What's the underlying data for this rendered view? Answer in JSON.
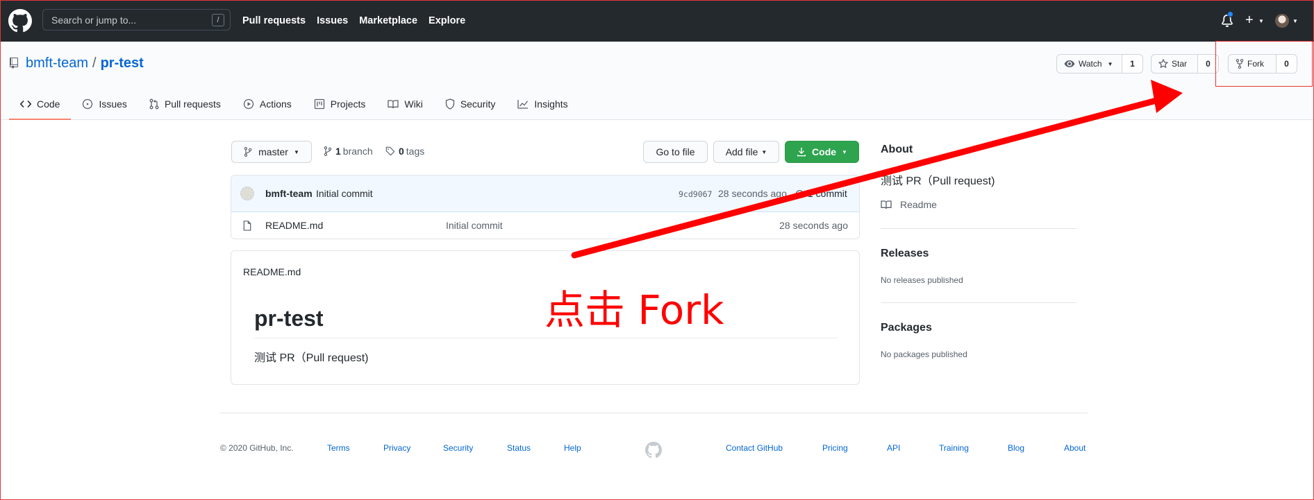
{
  "topbar": {
    "search_placeholder": "Search or jump to...",
    "search_shortcut": "/",
    "nav": [
      "Pull requests",
      "Issues",
      "Marketplace",
      "Explore"
    ]
  },
  "repo": {
    "owner": "bmft-team",
    "separator": "/",
    "name": "pr-test",
    "actions": {
      "watch_label": "Watch",
      "watch_count": "1",
      "star_label": "Star",
      "star_count": "0",
      "fork_label": "Fork",
      "fork_count": "0"
    },
    "tabs": [
      "Code",
      "Issues",
      "Pull requests",
      "Actions",
      "Projects",
      "Wiki",
      "Security",
      "Insights"
    ]
  },
  "main": {
    "branch_button": "master",
    "branch_count": "1",
    "branch_word": "branch",
    "tag_count": "0",
    "tag_word": "tags",
    "go_to_file": "Go to file",
    "add_file": "Add file",
    "code_button": "Code",
    "latest_commit": {
      "author": "bmft-team",
      "message": "Initial commit",
      "sha": "9cd9067",
      "time": "28 seconds ago",
      "count_label": "1 commit"
    },
    "files": [
      {
        "name": "README.md",
        "message": "Initial commit",
        "time": "28 seconds ago"
      }
    ],
    "readme": {
      "header": "README.md",
      "heading": "pr-test",
      "body": "测试 PR（Pull request)"
    }
  },
  "sidebar": {
    "about_heading": "About",
    "about_text": "测试 PR（Pull request)",
    "readme_link": "Readme",
    "releases_heading": "Releases",
    "releases_text": "No releases published",
    "packages_heading": "Packages",
    "packages_text": "No packages published"
  },
  "footer": {
    "copyright": "© 2020 GitHub, Inc.",
    "left_links": [
      "Terms",
      "Privacy",
      "Security",
      "Status",
      "Help"
    ],
    "right_links": [
      "Contact GitHub",
      "Pricing",
      "API",
      "Training",
      "Blog",
      "About"
    ]
  },
  "annotation": {
    "text": "点击 Fork",
    "color": "#ff0000"
  },
  "colors": {
    "header_bg": "#24292e",
    "link": "#0366d6",
    "green_button": "#2ea44f",
    "selected_tab_underline": "#f9826c"
  }
}
